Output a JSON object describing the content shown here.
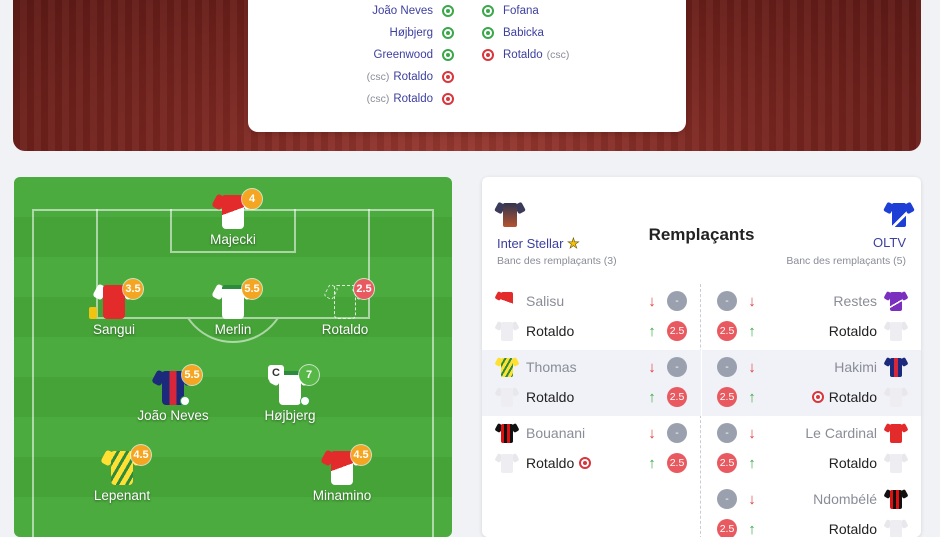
{
  "scorecard": {
    "home_goals": [
      {
        "name": "João Neves",
        "type": "goal",
        "csc": ""
      },
      {
        "name": "Højbjerg",
        "type": "goal",
        "csc": ""
      },
      {
        "name": "Greenwood",
        "type": "goal",
        "csc": ""
      },
      {
        "name": "Rotaldo",
        "type": "own_goal",
        "csc": "(csc)"
      },
      {
        "name": "Rotaldo",
        "type": "own_goal",
        "csc": "(csc)"
      }
    ],
    "away_goals": [
      {
        "name": "Fofana",
        "type": "goal",
        "csc": ""
      },
      {
        "name": "Babicka",
        "type": "goal",
        "csc": ""
      },
      {
        "name": "Rotaldo",
        "type": "own_goal",
        "csc": "(csc)"
      }
    ]
  },
  "pitch": {
    "players": [
      {
        "name": "Majecki",
        "rating": "4",
        "rating_color": "orange",
        "kit": "monaco"
      },
      {
        "name": "Sangui",
        "rating": "3.5",
        "rating_color": "orange",
        "kit": "red"
      },
      {
        "name": "Merlin",
        "rating": "5.5",
        "rating_color": "orange",
        "kit": "white-green"
      },
      {
        "name": "Rotaldo",
        "rating": "2.5",
        "rating_color": "red",
        "kit": "ghost"
      },
      {
        "name": "João Neves",
        "rating": "5.5",
        "rating_color": "orange",
        "kit": "psg"
      },
      {
        "name": "Højbjerg",
        "rating": "7",
        "rating_color": "green",
        "kit": "white",
        "captain": "C"
      },
      {
        "name": "Lepenant",
        "rating": "4.5",
        "rating_color": "orange",
        "kit": "nantes"
      },
      {
        "name": "Minamino",
        "rating": "4.5",
        "rating_color": "orange",
        "kit": "monaco"
      }
    ]
  },
  "substitutes": {
    "title": "Remplaçants",
    "home": {
      "team": "Inter Stellar",
      "bench": "Banc des remplaçants (3)"
    },
    "away": {
      "team": "OLTV",
      "bench": "Banc des remplaçants (5)"
    },
    "home_pairs": [
      {
        "out": "Salisu",
        "out_chip": "-",
        "in": "Rotaldo",
        "in_chip": "2.5",
        "out_kit": "red-white",
        "in_kit": "ghost"
      },
      {
        "out": "Thomas",
        "out_chip": "-",
        "in": "Rotaldo",
        "in_chip": "2.5",
        "out_kit": "nantes",
        "in_kit": "ghost"
      },
      {
        "out": "Bouanani",
        "out_chip": "-",
        "in": "Rotaldo",
        "in_chip": "2.5",
        "out_kit": "milan",
        "in_kit": "ghost",
        "in_goal": "own"
      }
    ],
    "away_pairs": [
      {
        "out": "Restes",
        "out_chip": "-",
        "in": "Rotaldo",
        "in_chip": "2.5",
        "out_kit": "purple",
        "in_kit": "ghost"
      },
      {
        "out": "Hakimi",
        "out_chip": "-",
        "in": "Rotaldo",
        "in_chip": "2.5",
        "out_kit": "psg",
        "in_kit": "ghost",
        "in_goal": "own"
      },
      {
        "out": "Le Cardinal",
        "out_chip": "-",
        "in": "Rotaldo",
        "in_chip": "2.5",
        "out_kit": "red",
        "in_kit": "ghost"
      },
      {
        "out": "Ndombélé",
        "out_chip": "-",
        "in": "Rotaldo",
        "in_chip": "2.5",
        "out_kit": "milan",
        "in_kit": "ghost"
      }
    ]
  },
  "colors": {
    "accent": "#3c3f9f",
    "pitch": "#4cab3e",
    "rating_orange": "#f4a623",
    "rating_red": "#e85a5f",
    "rating_green": "#57b848"
  }
}
